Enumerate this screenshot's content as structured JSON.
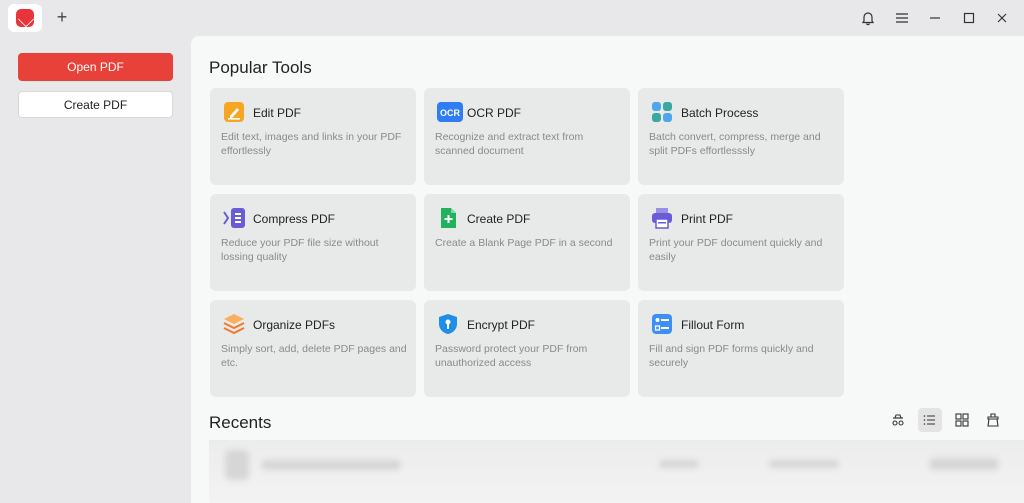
{
  "titlebar": {
    "logo_text": "PDF",
    "new_tab": "+"
  },
  "sidebar": {
    "open_label": "Open PDF",
    "create_label": "Create PDF"
  },
  "main": {
    "popular_title": "Popular Tools",
    "recents_title": "Recents",
    "tools": [
      {
        "title": "Edit PDF",
        "desc": "Edit text, images and links in your PDF effortlessly",
        "icon": "edit-pdf-icon",
        "color": "#f6a623"
      },
      {
        "title": "OCR PDF",
        "desc": "Recognize and extract text from scanned document",
        "icon": "ocr-icon",
        "color": "#2f7cf6"
      },
      {
        "title": "Batch Process",
        "desc": "Batch convert, compress, merge and split PDFs effortlesssly",
        "icon": "batch-icon",
        "color": "#3aa7a0"
      },
      {
        "title": "Compress PDF",
        "desc": "Reduce your PDF file size without lossing quality",
        "icon": "compress-icon",
        "color": "#6a5bd6"
      },
      {
        "title": "Create PDF",
        "desc": "Create a Blank Page PDF in a second",
        "icon": "create-pdf-icon",
        "color": "#22b15c"
      },
      {
        "title": "Print PDF",
        "desc": "Print your PDF document quickly and easily",
        "icon": "print-icon",
        "color": "#6a5bd6"
      },
      {
        "title": "Organize PDFs",
        "desc": "Simply sort, add, delete PDF pages and etc.",
        "icon": "organize-icon",
        "color": "#f07a2c"
      },
      {
        "title": "Encrypt PDF",
        "desc": "Password protect your PDF from unauthorized access",
        "icon": "encrypt-icon",
        "color": "#1f8ee8"
      },
      {
        "title": "Fillout Form",
        "desc": "Fill and sign PDF forms quickly and securely",
        "icon": "form-icon",
        "color": "#3d8ff5"
      }
    ]
  }
}
